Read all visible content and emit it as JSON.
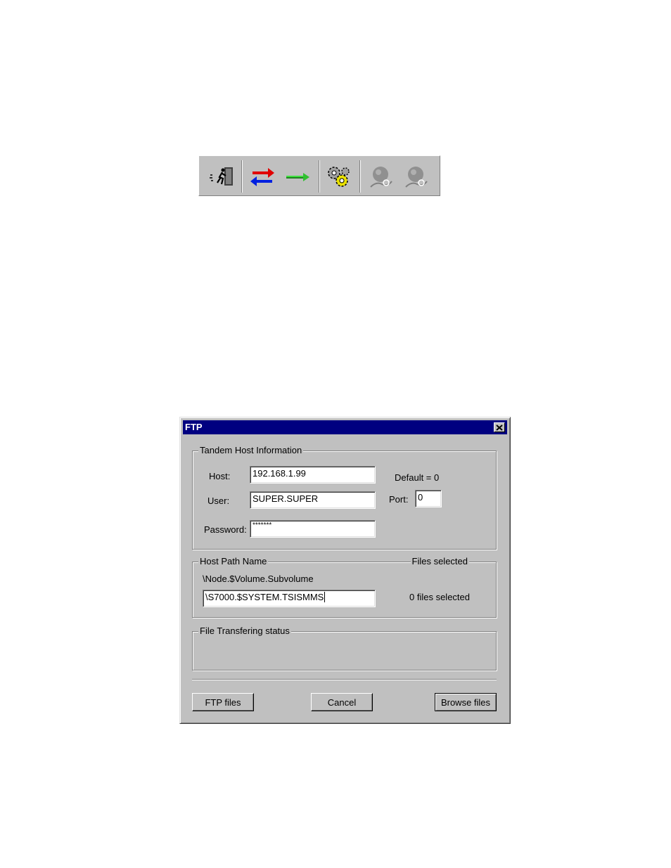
{
  "toolbar": {
    "buttons": [
      {
        "icon": "exit-door-icon",
        "enabled": true
      },
      {
        "icon": "transfer-arrows-icon",
        "enabled": true
      },
      {
        "icon": "green-arrow-icon",
        "enabled": true
      },
      {
        "icon": "gears-icon",
        "enabled": true
      },
      {
        "icon": "globe-disabled-icon",
        "enabled": false
      },
      {
        "icon": "globe-disabled-icon",
        "enabled": false
      }
    ]
  },
  "dialog": {
    "title": "FTP",
    "host_group": {
      "legend": "Tandem Host Information",
      "host_label": "Host:",
      "host_value": "192.168.1.99",
      "user_label": "User:",
      "user_value": "SUPER.SUPER",
      "password_label": "Password:",
      "password_value": "*******",
      "default_note": "Default = 0",
      "port_label": "Port:",
      "port_value": "0"
    },
    "path_group": {
      "legend": "Host Path Name",
      "files_legend": "Files selected",
      "path_format": "\\Node.$Volume.Subvolume",
      "path_value": "\\S7000.$SYSTEM.TSISMMS",
      "files_count": "0 files selected"
    },
    "status_group": {
      "legend": "File Transfering status"
    },
    "buttons": {
      "ftp": "FTP files",
      "cancel": "Cancel",
      "browse": "Browse files"
    }
  }
}
